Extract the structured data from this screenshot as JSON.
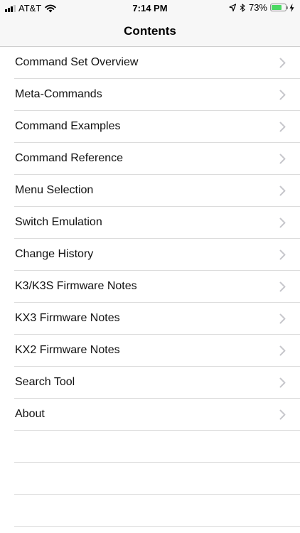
{
  "status_bar": {
    "carrier": "AT&T",
    "time": "7:14 PM",
    "battery_percent": "73%",
    "battery_level": 0.73,
    "icons": [
      "signal-icon",
      "wifi-icon",
      "location-icon",
      "bluetooth-icon",
      "battery-icon",
      "charging-icon"
    ]
  },
  "nav": {
    "title": "Contents"
  },
  "items": [
    {
      "label": "Command Set Overview"
    },
    {
      "label": "Meta-Commands"
    },
    {
      "label": "Command Examples"
    },
    {
      "label": "Command Reference"
    },
    {
      "label": "Menu Selection"
    },
    {
      "label": "Switch Emulation"
    },
    {
      "label": "Change History"
    },
    {
      "label": "K3/K3S Firmware Notes"
    },
    {
      "label": "KX3 Firmware Notes"
    },
    {
      "label": "KX2 Firmware Notes"
    },
    {
      "label": "Search Tool"
    },
    {
      "label": "About"
    }
  ],
  "colors": {
    "bar_background": "#f7f7f7",
    "separator": "#dcdcdc",
    "chevron": "#c7c7cc",
    "battery_fill": "#4cd964"
  }
}
